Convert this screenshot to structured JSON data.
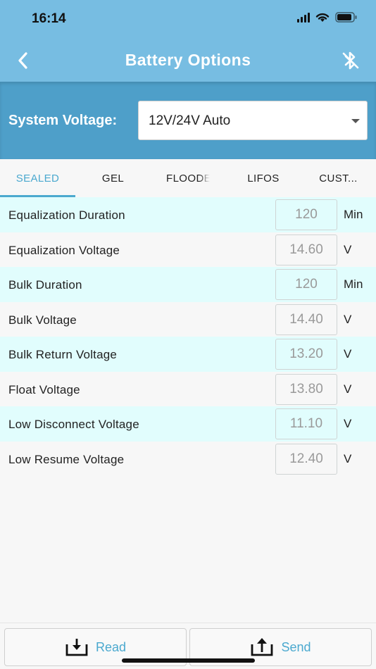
{
  "status_bar": {
    "time": "16:14"
  },
  "nav": {
    "title": "Battery Options",
    "back_icon": "chevron-left-icon",
    "action_icon": "bluetooth-icon"
  },
  "system_voltage": {
    "label": "System Voltage:",
    "selected": "12V/24V Auto"
  },
  "tabs": [
    {
      "label": "SEALED",
      "active": true
    },
    {
      "label": "GEL",
      "active": false
    },
    {
      "label": "FLOODE",
      "active": false
    },
    {
      "label": "LIFOS",
      "active": false
    },
    {
      "label": "CUST...",
      "active": false
    }
  ],
  "settings": [
    {
      "label": "Equalization Duration",
      "value": "120",
      "unit": "Min"
    },
    {
      "label": "Equalization Voltage",
      "value": "14.60",
      "unit": "V"
    },
    {
      "label": "Bulk Duration",
      "value": "120",
      "unit": "Min"
    },
    {
      "label": "Bulk Voltage",
      "value": "14.40",
      "unit": "V"
    },
    {
      "label": "Bulk Return Voltage",
      "value": "13.20",
      "unit": "V"
    },
    {
      "label": "Float Voltage",
      "value": "13.80",
      "unit": "V"
    },
    {
      "label": "Low Disconnect Voltage",
      "value": "11.10",
      "unit": "V"
    },
    {
      "label": "Low Resume Voltage",
      "value": "12.40",
      "unit": "V"
    }
  ],
  "actions": {
    "read_label": "Read",
    "send_label": "Send"
  },
  "colors": {
    "header": "#77bde2",
    "voltage_bar": "#4e9fc9",
    "accent": "#4ba9cf",
    "row_alt": "#e1fdfd"
  }
}
